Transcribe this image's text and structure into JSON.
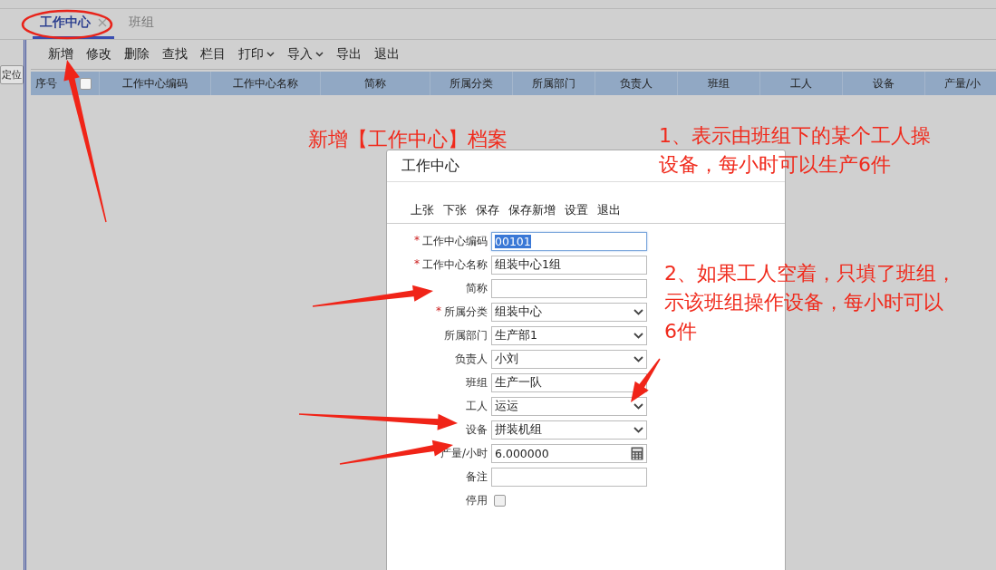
{
  "tabs": [
    {
      "label": "工作中心",
      "selected": true,
      "closable": true
    },
    {
      "label": "班组",
      "selected": false,
      "closable": false
    }
  ],
  "toolbar": [
    {
      "label": "新增",
      "kind": "button"
    },
    {
      "label": "修改",
      "kind": "button"
    },
    {
      "label": "删除",
      "kind": "button"
    },
    {
      "label": "查找",
      "kind": "button"
    },
    {
      "label": "栏目",
      "kind": "button"
    },
    {
      "label": "打印",
      "kind": "dropdown"
    },
    {
      "label": "导入",
      "kind": "dropdown"
    },
    {
      "label": "导出",
      "kind": "button"
    },
    {
      "label": "退出",
      "kind": "button"
    }
  ],
  "locate_button": "定位",
  "table": {
    "columns": [
      {
        "label": "序号",
        "kind": "text"
      },
      {
        "kind": "checkbox",
        "checked": false
      },
      {
        "label": "工作中心编码",
        "kind": "text"
      },
      {
        "label": "工作中心名称",
        "kind": "text"
      },
      {
        "label": "简称",
        "kind": "text"
      },
      {
        "label": "所属分类",
        "kind": "text"
      },
      {
        "label": "所属部门",
        "kind": "text"
      },
      {
        "label": "负责人",
        "kind": "text"
      },
      {
        "label": "班组",
        "kind": "text"
      },
      {
        "label": "工人",
        "kind": "text"
      },
      {
        "label": "设备",
        "kind": "text"
      },
      {
        "label": "产量/小",
        "kind": "text"
      }
    ]
  },
  "dialog": {
    "title": "工作中心",
    "toolbar": [
      "上张",
      "下张",
      "保存",
      "保存新增",
      "设置",
      "退出"
    ],
    "fields": [
      {
        "label": "工作中心编码",
        "kind": "text",
        "mark": "*",
        "value": "00101",
        "focused": true
      },
      {
        "label": "工作中心名称",
        "kind": "text",
        "mark": "*",
        "value": "组装中心1组",
        "focused": false
      },
      {
        "label": "简称",
        "kind": "text",
        "focused": false
      },
      {
        "label": "所属分类",
        "kind": "select",
        "mark": "*",
        "value": "组装中心",
        "focused": false
      },
      {
        "label": "所属部门",
        "kind": "select",
        "value": "生产部1",
        "focused": false
      },
      {
        "label": "负责人",
        "kind": "select",
        "value": "小刘",
        "focused": false
      },
      {
        "label": "班组",
        "kind": "text",
        "value": "生产一队",
        "focused": false
      },
      {
        "label": "工人",
        "kind": "select",
        "value": "运运",
        "focused": false
      },
      {
        "label": "设备",
        "kind": "select",
        "value": "拼装机组",
        "focused": false
      },
      {
        "label": "产量/小时",
        "kind": "number",
        "value": "6.000000",
        "focused": false
      },
      {
        "label": "备注",
        "kind": "text",
        "focused": false
      },
      {
        "label": "停用",
        "kind": "checkbox",
        "checked": false
      }
    ]
  },
  "annotations": [
    {
      "lines": [
        "新增【工作中心】档案"
      ]
    },
    {
      "lines": [
        "1、表示由班组下的某个工人操",
        "设备，每小时可以生产6件"
      ]
    },
    {
      "lines": [
        "2、如果工人空着，只填了班组，",
        "示该班组操作设备，每小时可以",
        "6件"
      ]
    }
  ]
}
